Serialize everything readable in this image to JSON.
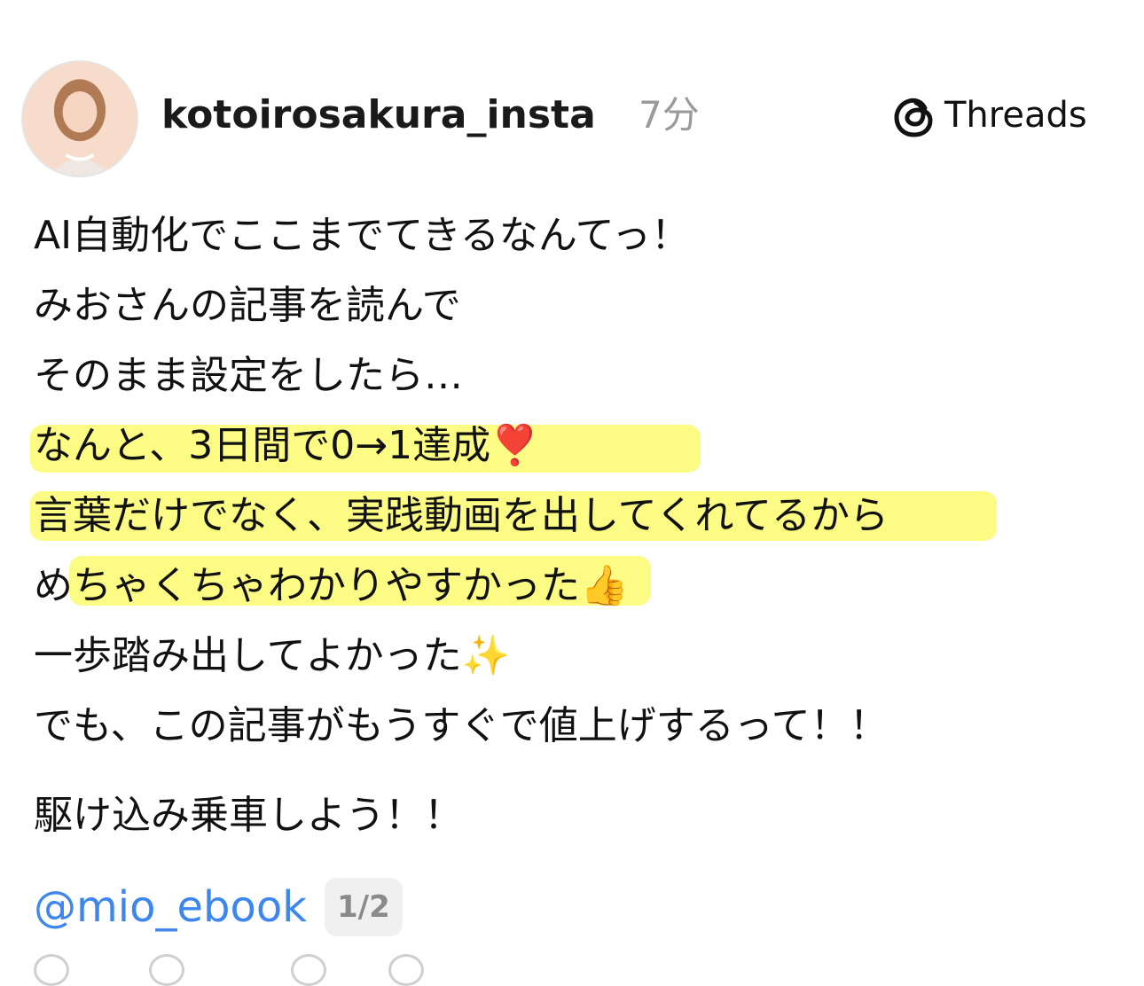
{
  "post": {
    "username": "kotoirosakura_insta",
    "time": "7分",
    "source_label": "Threads",
    "lines": [
      "AI自動化でここまでてきるなんてっ！",
      "みおさんの記事を読んで",
      "そのまま設定をしたら…",
      "なんと、3日間で0→1達成❣️",
      "言葉だけでなく、実践動画を出してくれてるから",
      "めちゃくちゃわかりやすかった👍",
      "一歩踏み出してよかった✨",
      "でも、この記事がもうすぐで値上げするって！！",
      "駆け込み乗車しよう！！"
    ],
    "mention": "@mio_ebook",
    "page_indicator": "1/2"
  },
  "icons": {
    "avatar": "profile-avatar",
    "threads": "threads-logo-icon"
  },
  "colors": {
    "highlight": "#fbfa5a",
    "mention": "#3d86ee",
    "muted": "#9a9a9a"
  }
}
